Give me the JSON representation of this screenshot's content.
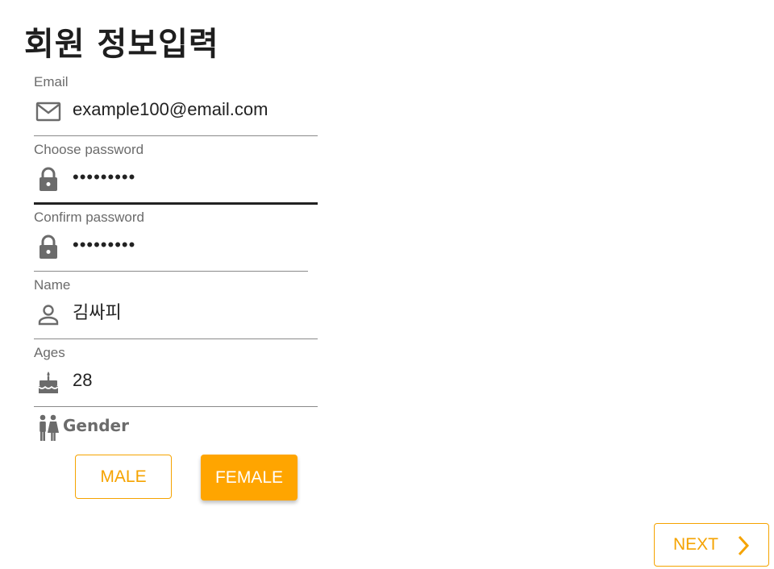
{
  "page": {
    "title": "회원 정보입력"
  },
  "form": {
    "email": {
      "label": "Email",
      "value": "example100@email.com",
      "icon": "mail-icon"
    },
    "password": {
      "label": "Choose password",
      "value": "•••••••••",
      "icon": "lock-icon"
    },
    "confirm": {
      "label": "Confirm password",
      "value": "•••••••••",
      "icon": "lock-icon"
    },
    "name": {
      "label": "Name",
      "value": "김싸피",
      "icon": "person-icon"
    },
    "ages": {
      "label": "Ages",
      "value": "28",
      "icon": "cake-icon"
    },
    "gender": {
      "label": "Gender",
      "icon": "people-icon",
      "options": [
        "MALE",
        "FEMALE"
      ],
      "selected": "FEMALE"
    }
  },
  "actions": {
    "next_label": "NEXT",
    "icon": "chevron-right-icon"
  },
  "colors": {
    "accent": "#ffa500",
    "label": "#6b6b6b",
    "text": "#222222"
  }
}
